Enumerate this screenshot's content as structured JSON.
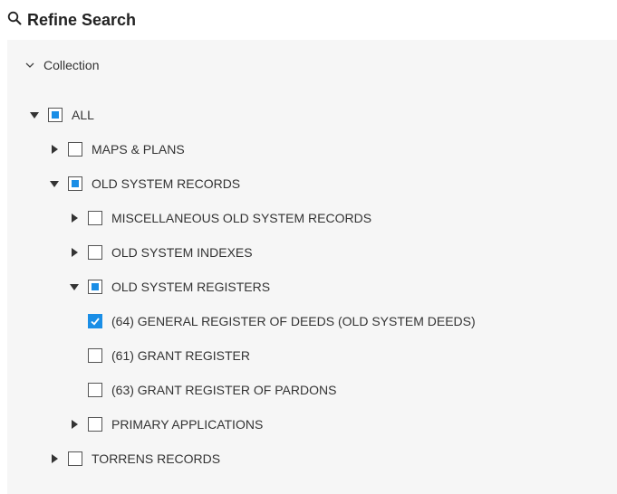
{
  "header": {
    "title": "Refine Search",
    "icon": "search-icon"
  },
  "section": {
    "label": "Collection",
    "icon": "chevron-down-icon",
    "expanded": true
  },
  "colors": {
    "accent": "#1a8ee6",
    "panel_bg": "#f6f6f6",
    "text": "#333333"
  },
  "tree": [
    {
      "label": "ALL",
      "level": 0,
      "toggle": "expanded",
      "state": "partial"
    },
    {
      "label": "MAPS & PLANS",
      "level": 1,
      "toggle": "collapsed",
      "state": "unchecked"
    },
    {
      "label": "OLD SYSTEM RECORDS",
      "level": 1,
      "toggle": "expanded",
      "state": "partial"
    },
    {
      "label": "MISCELLANEOUS OLD SYSTEM RECORDS",
      "level": 2,
      "toggle": "collapsed",
      "state": "unchecked"
    },
    {
      "label": "OLD SYSTEM INDEXES",
      "level": 2,
      "toggle": "collapsed",
      "state": "unchecked"
    },
    {
      "label": "OLD SYSTEM REGISTERS",
      "level": 2,
      "toggle": "expanded",
      "state": "partial"
    },
    {
      "label": "(64) GENERAL REGISTER OF DEEDS (OLD SYSTEM DEEDS)",
      "level": 3,
      "toggle": "none",
      "state": "checked"
    },
    {
      "label": "(61) GRANT REGISTER",
      "level": 3,
      "toggle": "none",
      "state": "unchecked"
    },
    {
      "label": "(63) GRANT REGISTER OF PARDONS",
      "level": 3,
      "toggle": "none",
      "state": "unchecked"
    },
    {
      "label": "PRIMARY APPLICATIONS",
      "level": 2,
      "toggle": "collapsed",
      "state": "unchecked"
    },
    {
      "label": "TORRENS RECORDS",
      "level": 1,
      "toggle": "collapsed",
      "state": "unchecked"
    }
  ]
}
